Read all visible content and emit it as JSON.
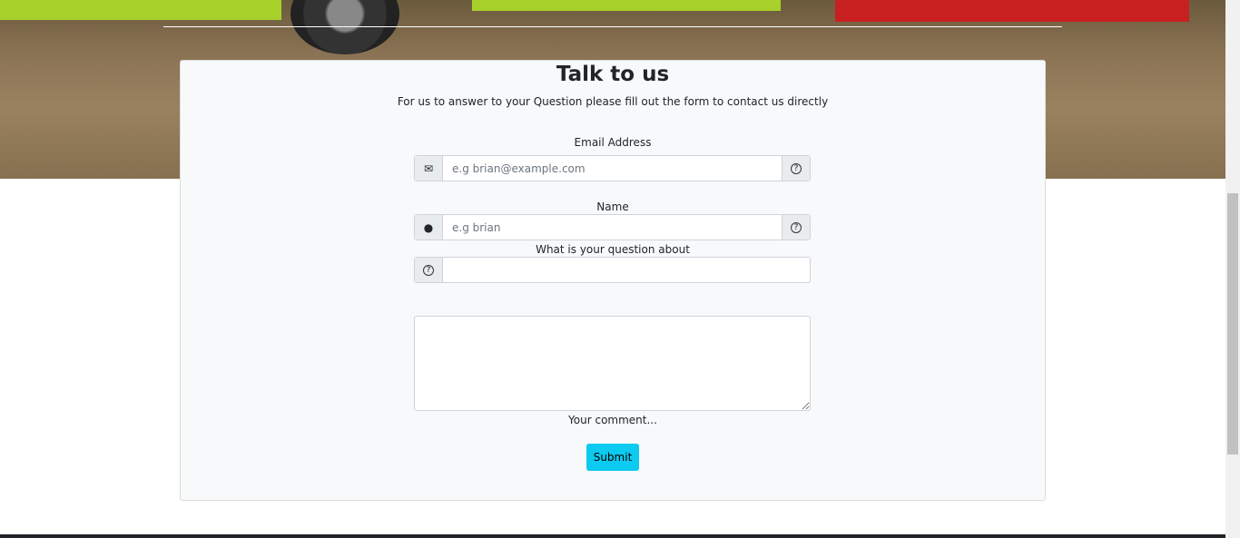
{
  "form": {
    "title": "Talk to us",
    "subtitle": "For us to answer to your Question please fill out the form to contact us directly",
    "email_label": "Email Address",
    "email_placeholder": "e.g brian@example.com",
    "name_label": "Name",
    "name_placeholder": "e.g brian",
    "question_label": "What is your question about",
    "comment_label": "Your comment...",
    "submit": "Submit"
  },
  "icons": {
    "email": "envelope-icon",
    "name": "person-icon",
    "help": "question-circle-icon"
  },
  "colors": {
    "submit": "#0dcaf0"
  }
}
